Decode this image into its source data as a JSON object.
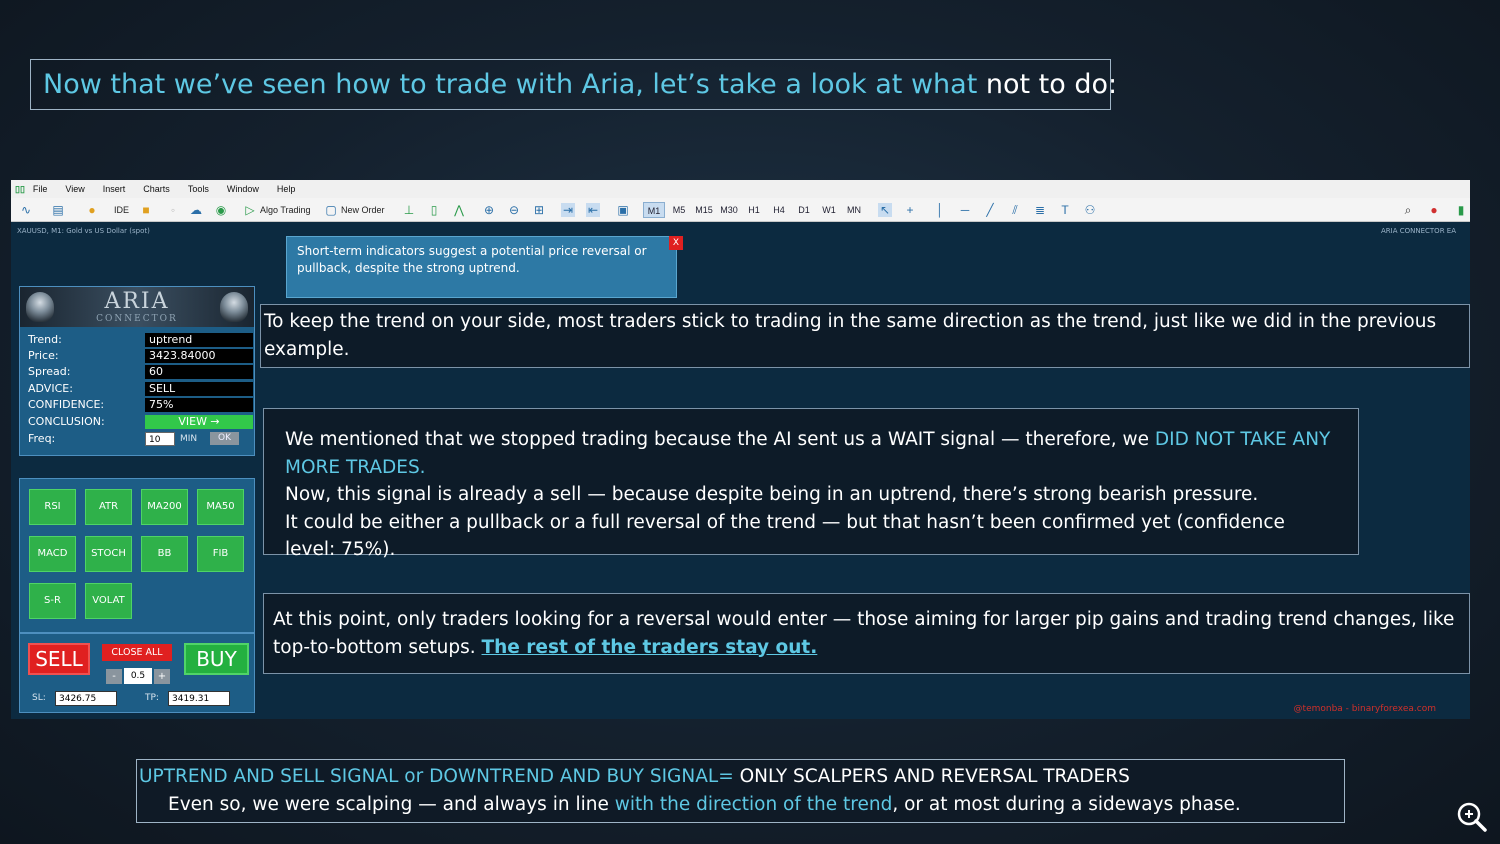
{
  "title": {
    "part1": "Now that we’ve seen how to trade with Aria, let’s take a look at what ",
    "part2": "not to do:"
  },
  "platform": {
    "menu": [
      "File",
      "View",
      "Insert",
      "Charts",
      "Tools",
      "Window",
      "Help"
    ],
    "toolbar": {
      "ide_label": "IDE",
      "algo_trading_label": "Algo Trading",
      "new_order_label": "New Order",
      "timeframes": [
        "M1",
        "M5",
        "M15",
        "M30",
        "H1",
        "H4",
        "D1",
        "W1",
        "MN"
      ],
      "active_timeframe": "M1"
    },
    "chart_info": "XAUUSD, M1: Gold vs US Dollar (spot)",
    "connector_label": "ARIA CONNECTOR EA",
    "watermark": "@temonba - binaryforexea.com"
  },
  "tooltip": {
    "text": "Short-term indicators suggest a potential price reversal or pullback, despite the strong uptrend.",
    "close_label": "X"
  },
  "aria": {
    "title": "ARIA",
    "subtitle": "CONNECTOR",
    "rows": [
      {
        "label": "Trend:",
        "value": "uptrend"
      },
      {
        "label": "Price:",
        "value": "3423.84000"
      },
      {
        "label": "Spread:",
        "value": "60"
      },
      {
        "label": "ADVICE:",
        "value": " SELL"
      },
      {
        "label": "CONFIDENCE:",
        "value": " 75%"
      },
      {
        "label": "CONCLUSION:",
        "value": "VIEW →"
      }
    ],
    "freq": {
      "label": "Freq:",
      "value": "10",
      "unit": "MIN",
      "ok_label": "OK"
    }
  },
  "indicators": [
    "RSI",
    "ATR",
    "MA200",
    "MA50",
    "MACD",
    "STOCH",
    "BB",
    "FIB",
    "S-R",
    "VOLAT"
  ],
  "trade": {
    "sell_label": "SELL",
    "buy_label": "BUY",
    "close_all_label": "CLOSE ALL",
    "minus_label": "-",
    "plus_label": "+",
    "lot": "0.5",
    "sl_label": "SL:",
    "sl_value": "3426.75",
    "tp_label": "TP:",
    "tp_value": "3419.31"
  },
  "box1": {
    "text": "To keep the trend on your side, most traders stick to trading in the same direction as the trend, just like we did in the previous example."
  },
  "box2": {
    "line1_part1": "We mentioned that we stopped trading because the AI sent us a WAIT signal —  therefore, we ",
    "line1_part2": "DID NOT TAKE ANY MORE TRADES.",
    "line2": "Now, this signal is already a sell — because despite being in an uptrend, there’s strong bearish pressure.",
    "line3": "It could be either a pullback or a full reversal of the trend — but that hasn’t been confirmed yet (confidence level: 75%)."
  },
  "box3": {
    "text": "At this point, only traders looking for a reversal would enter — those aiming for larger pip gains and trading trend changes, like top-to-bottom setups.  ",
    "link": "The rest of the traders stay out."
  },
  "bottom": {
    "line1_part1": "UPTREND AND SELL SIGNAL or DOWNTREND AND BUY SIGNAL=",
    "line1_part2": " ONLY SCALPERS AND REVERSAL TRADERS",
    "line2_part1": "Even so, we were scalping — and always in line ",
    "line2_part2": "with the direction of the trend",
    "line2_part3": ", or at most during a sideways phase."
  },
  "colors": {
    "accent_cyan": "#5ec8e4",
    "sell_red": "#e02020",
    "buy_green": "#24b040",
    "panel_blue": "#1d5d86"
  }
}
